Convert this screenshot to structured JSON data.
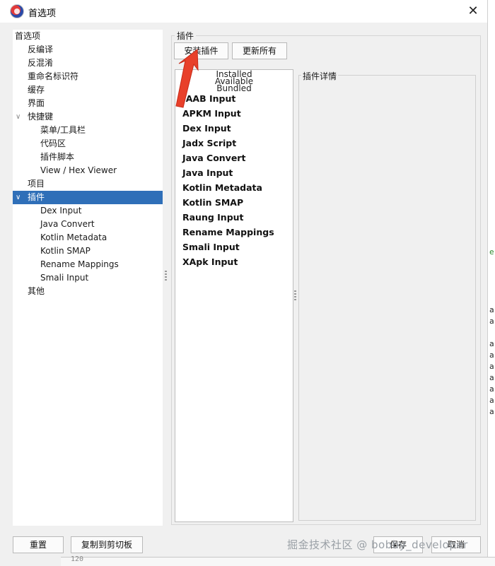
{
  "window": {
    "title": "首选项",
    "close_glyph": "✕"
  },
  "tree": {
    "items": [
      {
        "label": "首选项",
        "level": 0
      },
      {
        "label": "反编译",
        "level": 1
      },
      {
        "label": "反混淆",
        "level": 1
      },
      {
        "label": "重命名标识符",
        "level": 1
      },
      {
        "label": "缓存",
        "level": 1
      },
      {
        "label": "界面",
        "level": 1
      },
      {
        "label": "快捷键",
        "level": 1,
        "expanded": true
      },
      {
        "label": "菜单/工具栏",
        "level": 2
      },
      {
        "label": "代码区",
        "level": 2
      },
      {
        "label": "插件脚本",
        "level": 2
      },
      {
        "label": "View / Hex Viewer",
        "level": 2
      },
      {
        "label": "项目",
        "level": 1
      },
      {
        "label": "插件",
        "level": 1,
        "expanded": true,
        "selected": true
      },
      {
        "label": "Dex Input",
        "level": 2
      },
      {
        "label": "Java Convert",
        "level": 2
      },
      {
        "label": "Kotlin Metadata",
        "level": 2
      },
      {
        "label": "Kotlin SMAP",
        "level": 2
      },
      {
        "label": "Rename Mappings",
        "level": 2
      },
      {
        "label": "Smali Input",
        "level": 2
      },
      {
        "label": "其他",
        "level": 1
      }
    ],
    "caret_glyph": "∨"
  },
  "plugins": {
    "group_title": "插件",
    "install_button": "安装插件",
    "update_all_button": "更新所有",
    "list_headers": [
      "Installed",
      "Available",
      "Bundled"
    ],
    "list": [
      ".AAB Input",
      "APKM Input",
      "Dex Input",
      "Jadx Script",
      "Java Convert",
      "Java Input",
      "Kotlin Metadata",
      "Kotlin SMAP",
      "Raung Input",
      "Rename Mappings",
      "Smali Input",
      "XApk Input"
    ],
    "details_title": "插件详情"
  },
  "footer": {
    "reset_button": "重置",
    "copy_button": "复制到剪切板",
    "save_button": "保存",
    "cancel_button": "取消"
  },
  "watermark": "掘金技术社区 @ bobby_developer",
  "background_window": {
    "chars": [
      "e",
      "a",
      "a",
      "a",
      "a",
      "a",
      "a",
      "a",
      "a",
      "a"
    ],
    "line_number": "120"
  },
  "colors": {
    "selection": "#2f6fb8",
    "arrow": "#e8402a",
    "background": "#f0f0f0"
  }
}
